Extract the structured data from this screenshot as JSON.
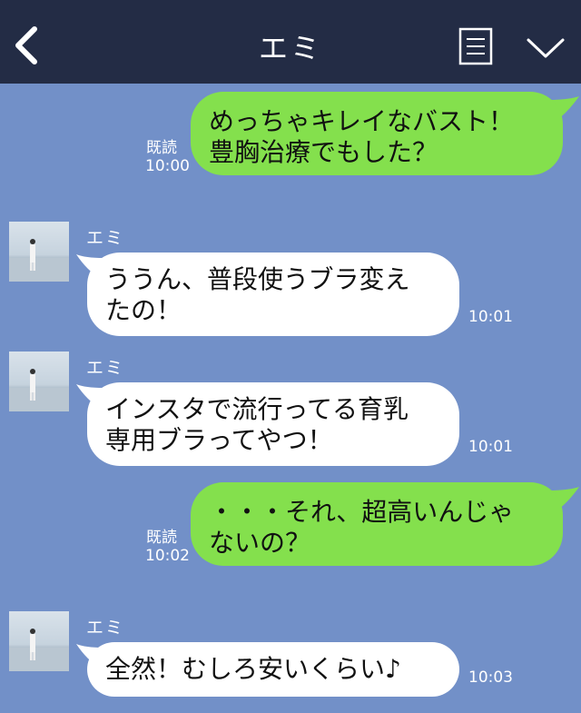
{
  "header": {
    "title": "エミ"
  },
  "messages": [
    {
      "direction": "out",
      "text": "めっちゃキレイなバスト！\n豊胸治療でもした？",
      "read": "既読",
      "time": "10:00"
    },
    {
      "direction": "in",
      "sender": "エミ",
      "text": "ううん、普段使うブラ変え\nたの！",
      "time": "10:01"
    },
    {
      "direction": "in",
      "sender": "エミ",
      "text": "インスタで流行ってる育乳\n専用ブラってやつ！",
      "time": "10:01"
    },
    {
      "direction": "out",
      "text": "・・・それ、超高いんじゃ\nないの？",
      "read": "既読",
      "time": "10:02"
    },
    {
      "direction": "in",
      "sender": "エミ",
      "text": "全然！むしろ安いくらい♪",
      "time": "10:03"
    }
  ],
  "colors": {
    "header_bg": "#232c45",
    "chat_bg": "#7290c8",
    "outgoing_bubble": "#84e04d",
    "incoming_bubble": "#ffffff"
  }
}
